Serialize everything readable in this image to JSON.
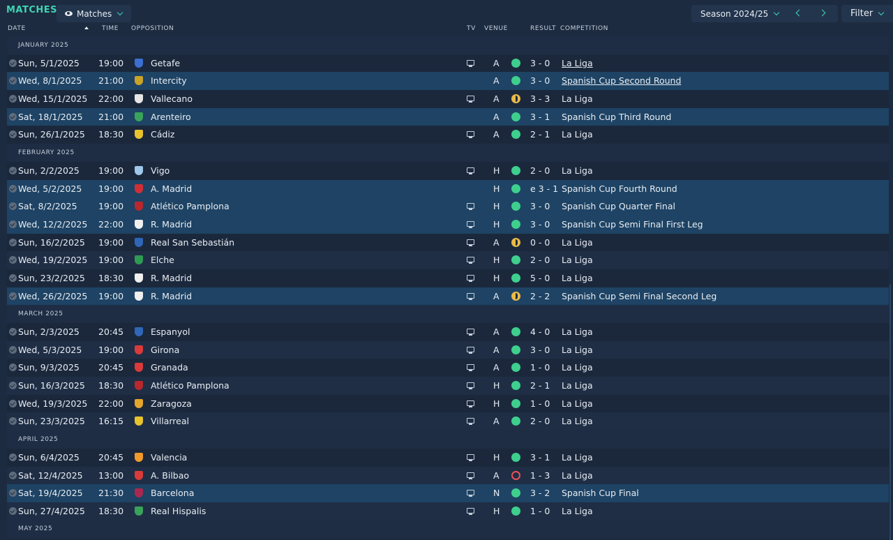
{
  "header": {
    "title": "MATCHES",
    "view_label": "Matches",
    "season_label": "Season 2024/25",
    "filter_label": "Filter"
  },
  "columns": {
    "date": "DATE",
    "time": "TIME",
    "opposition": "OPPOSITION",
    "tv": "TV",
    "venue": "VENUE",
    "result": "RESULT",
    "competition": "COMPETITION"
  },
  "colors": {
    "accent": "#3fd3b4",
    "win": "#3ecf8e",
    "draw": "#e9b949",
    "loss": "#e8525a",
    "highlight_row": "#1e4364"
  },
  "groups": [
    {
      "month": "JANUARY 2025",
      "matches": [
        {
          "date": "Sun, 5/1/2025",
          "time": "19:00",
          "opp": "Getafe",
          "crest": "#3b6fd1",
          "tv": true,
          "venue": "A",
          "outcome": "W",
          "score": "3 - 0",
          "comp": "La Liga",
          "u": true,
          "hl": false
        },
        {
          "date": "Wed, 8/1/2025",
          "time": "21:00",
          "opp": "Intercity",
          "crest": "#c9a227",
          "tv": false,
          "venue": "A",
          "outcome": "W",
          "score": "3 - 0",
          "comp": "Spanish Cup Second Round",
          "u": true,
          "hl": true
        },
        {
          "date": "Wed, 15/1/2025",
          "time": "22:00",
          "opp": "Vallecano",
          "crest": "#e6e6e6",
          "tv": true,
          "venue": "A",
          "outcome": "D",
          "score": "3 - 3",
          "comp": "La Liga",
          "u": false,
          "hl": false
        },
        {
          "date": "Sat, 18/1/2025",
          "time": "21:00",
          "opp": "Arenteiro",
          "crest": "#3aa35b",
          "tv": false,
          "venue": "A",
          "outcome": "W",
          "score": "3 - 1",
          "comp": "Spanish Cup Third Round",
          "u": false,
          "hl": true
        },
        {
          "date": "Sun, 26/1/2025",
          "time": "18:30",
          "opp": "Cádiz",
          "crest": "#e8c32e",
          "tv": true,
          "venue": "A",
          "outcome": "W",
          "score": "2 - 1",
          "comp": "La Liga",
          "u": false,
          "hl": false
        }
      ]
    },
    {
      "month": "FEBRUARY 2025",
      "matches": [
        {
          "date": "Sun, 2/2/2025",
          "time": "19:00",
          "opp": "Vigo",
          "crest": "#9fc7ea",
          "tv": true,
          "venue": "H",
          "outcome": "W",
          "score": "2 - 0",
          "comp": "La Liga",
          "u": false,
          "hl": false
        },
        {
          "date": "Wed, 5/2/2025",
          "time": "19:00",
          "opp": "A. Madrid",
          "crest": "#cf2f36",
          "tv": false,
          "venue": "H",
          "outcome": "W",
          "score": "e 3 - 1",
          "comp": "Spanish Cup Fourth Round",
          "u": false,
          "hl": true
        },
        {
          "date": "Sat, 8/2/2025",
          "time": "19:00",
          "opp": "Atlético Pamplona",
          "crest": "#b8282e",
          "tv": true,
          "venue": "H",
          "outcome": "W",
          "score": "3 - 0",
          "comp": "Spanish Cup Quarter Final",
          "u": false,
          "hl": true
        },
        {
          "date": "Wed, 12/2/2025",
          "time": "22:00",
          "opp": "R. Madrid",
          "crest": "#f0f0f0",
          "tv": true,
          "venue": "H",
          "outcome": "W",
          "score": "3 - 0",
          "comp": "Spanish Cup Semi Final First Leg",
          "u": false,
          "hl": true
        },
        {
          "date": "Sun, 16/2/2025",
          "time": "19:00",
          "opp": "Real San Sebastián",
          "crest": "#2f66b8",
          "tv": true,
          "venue": "A",
          "outcome": "D",
          "score": "0 - 0",
          "comp": "La Liga",
          "u": false,
          "hl": false
        },
        {
          "date": "Wed, 19/2/2025",
          "time": "19:00",
          "opp": "Elche",
          "crest": "#2f9a53",
          "tv": true,
          "venue": "H",
          "outcome": "W",
          "score": "2 - 0",
          "comp": "La Liga",
          "u": false,
          "hl": false
        },
        {
          "date": "Sun, 23/2/2025",
          "time": "18:30",
          "opp": "R. Madrid",
          "crest": "#f0f0f0",
          "tv": true,
          "venue": "H",
          "outcome": "W",
          "score": "5 - 0",
          "comp": "La Liga",
          "u": false,
          "hl": false
        },
        {
          "date": "Wed, 26/2/2025",
          "time": "19:00",
          "opp": "R. Madrid",
          "crest": "#f0f0f0",
          "tv": true,
          "venue": "A",
          "outcome": "D",
          "score": "2 - 2",
          "comp": "Spanish Cup Semi Final Second Leg",
          "u": false,
          "hl": true
        }
      ]
    },
    {
      "month": "MARCH 2025",
      "matches": [
        {
          "date": "Sun, 2/3/2025",
          "time": "20:45",
          "opp": "Espanyol",
          "crest": "#2f66b8",
          "tv": true,
          "venue": "A",
          "outcome": "W",
          "score": "4 - 0",
          "comp": "La Liga",
          "u": false,
          "hl": false
        },
        {
          "date": "Wed, 5/3/2025",
          "time": "19:00",
          "opp": "Girona",
          "crest": "#d93a3a",
          "tv": true,
          "venue": "A",
          "outcome": "W",
          "score": "3 - 0",
          "comp": "La Liga",
          "u": false,
          "hl": false
        },
        {
          "date": "Sun, 9/3/2025",
          "time": "20:45",
          "opp": "Granada",
          "crest": "#d93a3a",
          "tv": true,
          "venue": "A",
          "outcome": "W",
          "score": "1 - 0",
          "comp": "La Liga",
          "u": false,
          "hl": false
        },
        {
          "date": "Sun, 16/3/2025",
          "time": "18:30",
          "opp": "Atlético Pamplona",
          "crest": "#b8282e",
          "tv": true,
          "venue": "H",
          "outcome": "W",
          "score": "2 - 1",
          "comp": "La Liga",
          "u": false,
          "hl": false
        },
        {
          "date": "Wed, 19/3/2025",
          "time": "22:00",
          "opp": "Zaragoza",
          "crest": "#e3a52c",
          "tv": true,
          "venue": "H",
          "outcome": "W",
          "score": "1 - 0",
          "comp": "La Liga",
          "u": false,
          "hl": false
        },
        {
          "date": "Sun, 23/3/2025",
          "time": "16:15",
          "opp": "Villarreal",
          "crest": "#e8c32e",
          "tv": true,
          "venue": "A",
          "outcome": "W",
          "score": "2 - 0",
          "comp": "La Liga",
          "u": false,
          "hl": false
        }
      ]
    },
    {
      "month": "APRIL 2025",
      "matches": [
        {
          "date": "Sun, 6/4/2025",
          "time": "20:45",
          "opp": "Valencia",
          "crest": "#f09a2a",
          "tv": true,
          "venue": "H",
          "outcome": "W",
          "score": "3 - 1",
          "comp": "La Liga",
          "u": false,
          "hl": false
        },
        {
          "date": "Sat, 12/4/2025",
          "time": "13:00",
          "opp": "A. Bilbao",
          "crest": "#d93a3a",
          "tv": true,
          "venue": "A",
          "outcome": "L",
          "score": "1 - 3",
          "comp": "La Liga",
          "u": false,
          "hl": false
        },
        {
          "date": "Sat, 19/4/2025",
          "time": "21:30",
          "opp": "Barcelona",
          "crest": "#a8294f",
          "tv": true,
          "venue": "N",
          "outcome": "W",
          "score": "3 - 2",
          "comp": "Spanish Cup Final",
          "u": false,
          "hl": true
        },
        {
          "date": "Sun, 27/4/2025",
          "time": "18:30",
          "opp": "Real Hispalis",
          "crest": "#3aa35b",
          "tv": true,
          "venue": "H",
          "outcome": "W",
          "score": "1 - 0",
          "comp": "La Liga",
          "u": false,
          "hl": false
        }
      ]
    },
    {
      "month": "MAY 2025",
      "matches": []
    }
  ]
}
